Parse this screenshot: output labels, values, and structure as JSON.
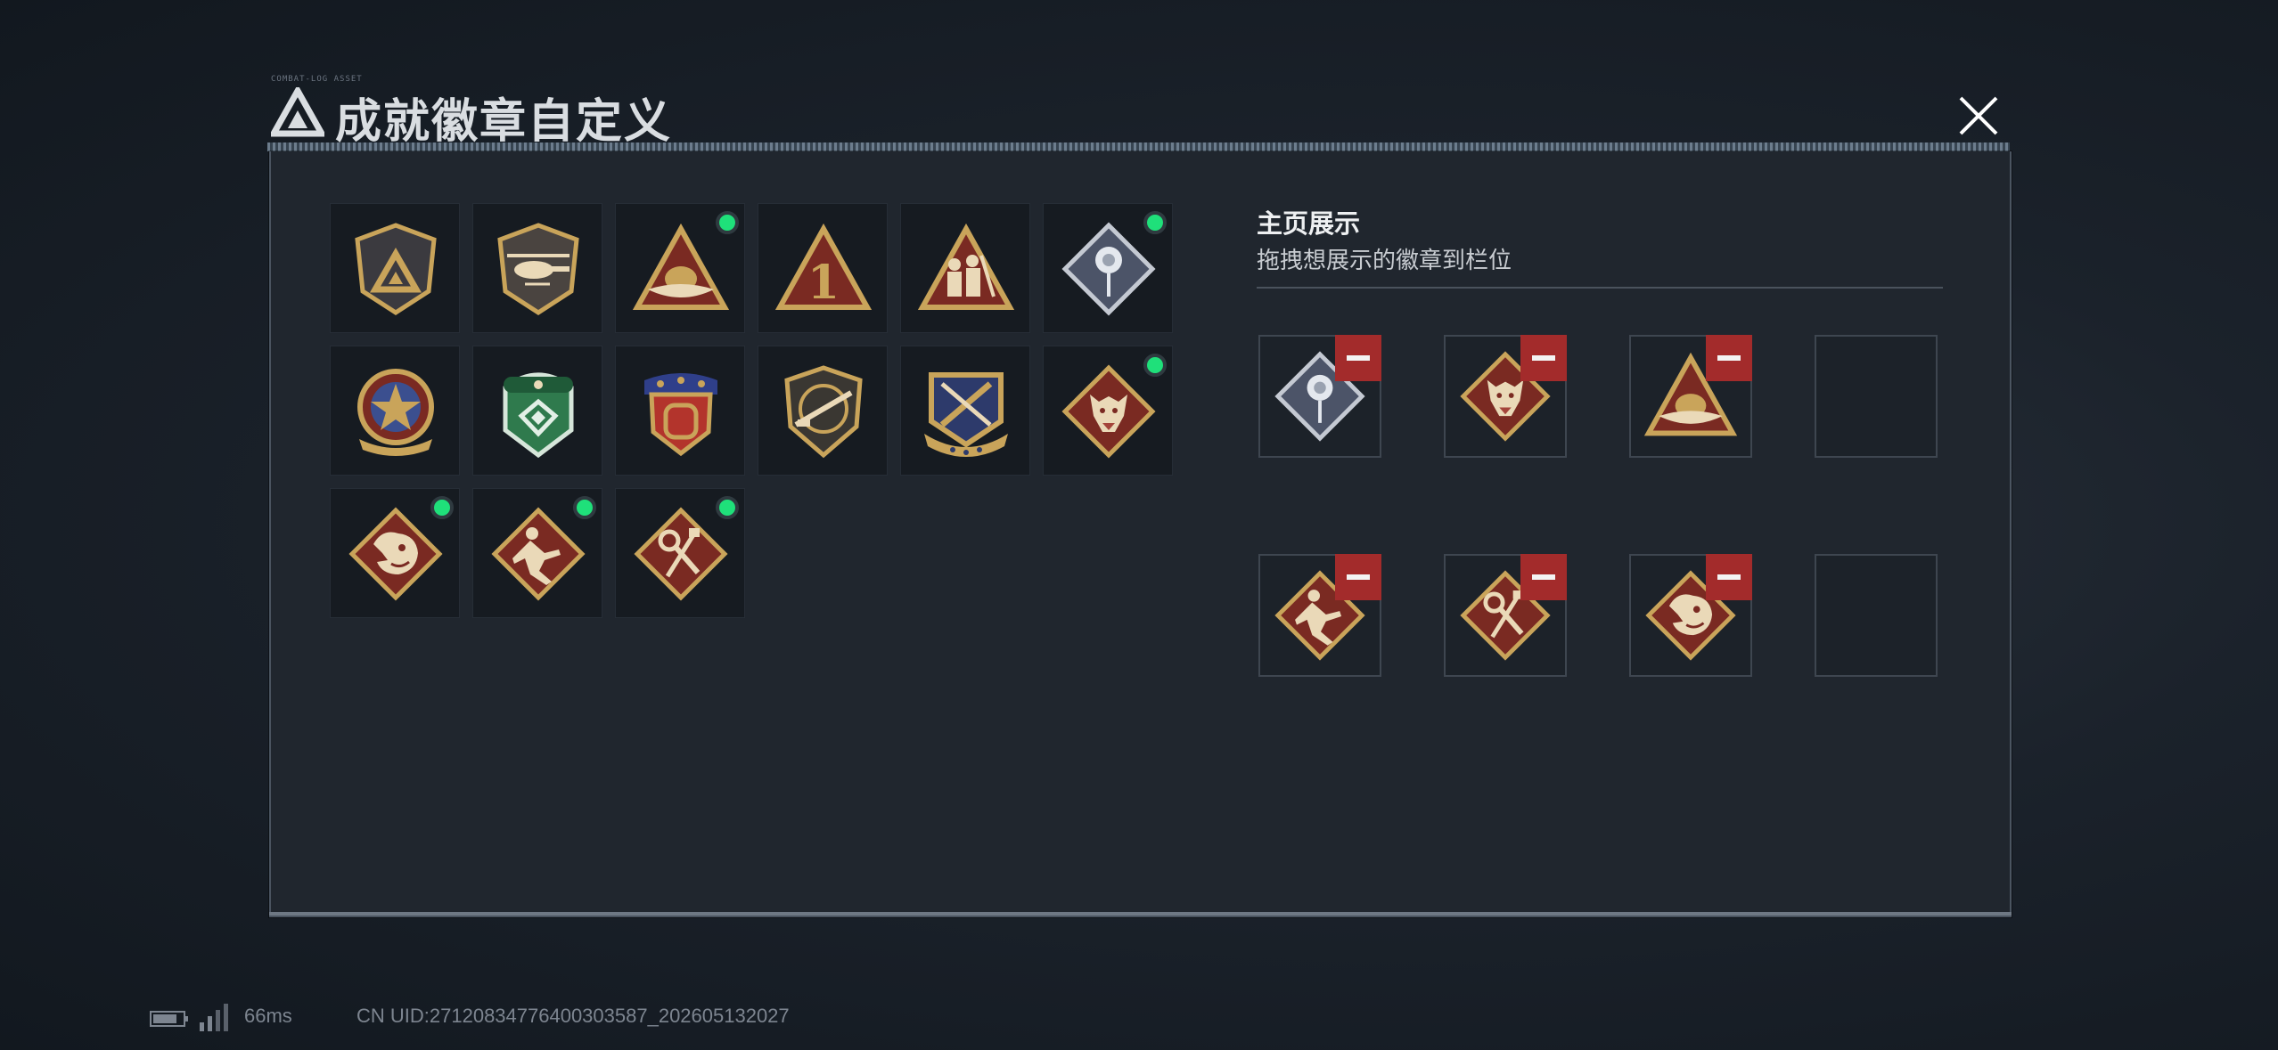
{
  "header": {
    "title": "成就徽章自定义",
    "tiny_text": "COMBAT-LOG ASSET",
    "close_icon": "close-icon"
  },
  "badges": [
    {
      "icon": "shield-triangle-badge-icon",
      "selected": false
    },
    {
      "icon": "helicopter-badge-icon",
      "selected": false
    },
    {
      "icon": "triangle-wing-badge-icon",
      "selected": true
    },
    {
      "icon": "triangle-number-one-badge-icon",
      "selected": false
    },
    {
      "icon": "triangle-soldiers-badge-icon",
      "selected": false
    },
    {
      "icon": "diamond-rose-badge-icon",
      "selected": true
    },
    {
      "icon": "star-medal-badge-icon",
      "selected": false
    },
    {
      "icon": "green-beret-badge-icon",
      "selected": false
    },
    {
      "icon": "red-stars-shield-badge-icon",
      "selected": false
    },
    {
      "icon": "rifle-shield-badge-icon",
      "selected": false
    },
    {
      "icon": "navy-crossed-rifles-badge-icon",
      "selected": false
    },
    {
      "icon": "diamond-wolf-badge-icon",
      "selected": true
    },
    {
      "icon": "diamond-dragon-badge-icon",
      "selected": true
    },
    {
      "icon": "diamond-runner-badge-icon",
      "selected": true
    },
    {
      "icon": "diamond-tools-badge-icon",
      "selected": true
    }
  ],
  "showcase": {
    "title": "主页展示",
    "subtitle": "拖拽想展示的徽章到栏位",
    "slots": [
      {
        "icon": "diamond-rose-badge-icon",
        "filled": true
      },
      {
        "icon": "diamond-wolf-badge-icon",
        "filled": true
      },
      {
        "icon": "triangle-wing-badge-icon",
        "filled": true
      },
      {
        "icon": "",
        "filled": false
      },
      {
        "icon": "diamond-runner-badge-icon",
        "filled": true
      },
      {
        "icon": "diamond-tools-badge-icon",
        "filled": true
      },
      {
        "icon": "diamond-dragon-badge-icon",
        "filled": true
      },
      {
        "icon": "",
        "filled": false
      }
    ]
  },
  "footer": {
    "ping": "66ms",
    "uid": "CN UID:27120834776400303587_202605132027",
    "battery_icon": "battery-icon",
    "signal_icon": "signal-icon"
  },
  "colors": {
    "selected_dot": "#1fe07a",
    "remove_button": "#a32b2b",
    "panel": "#20262e",
    "badge_gold": "#c9a45a",
    "badge_red": "#7a2a22"
  }
}
